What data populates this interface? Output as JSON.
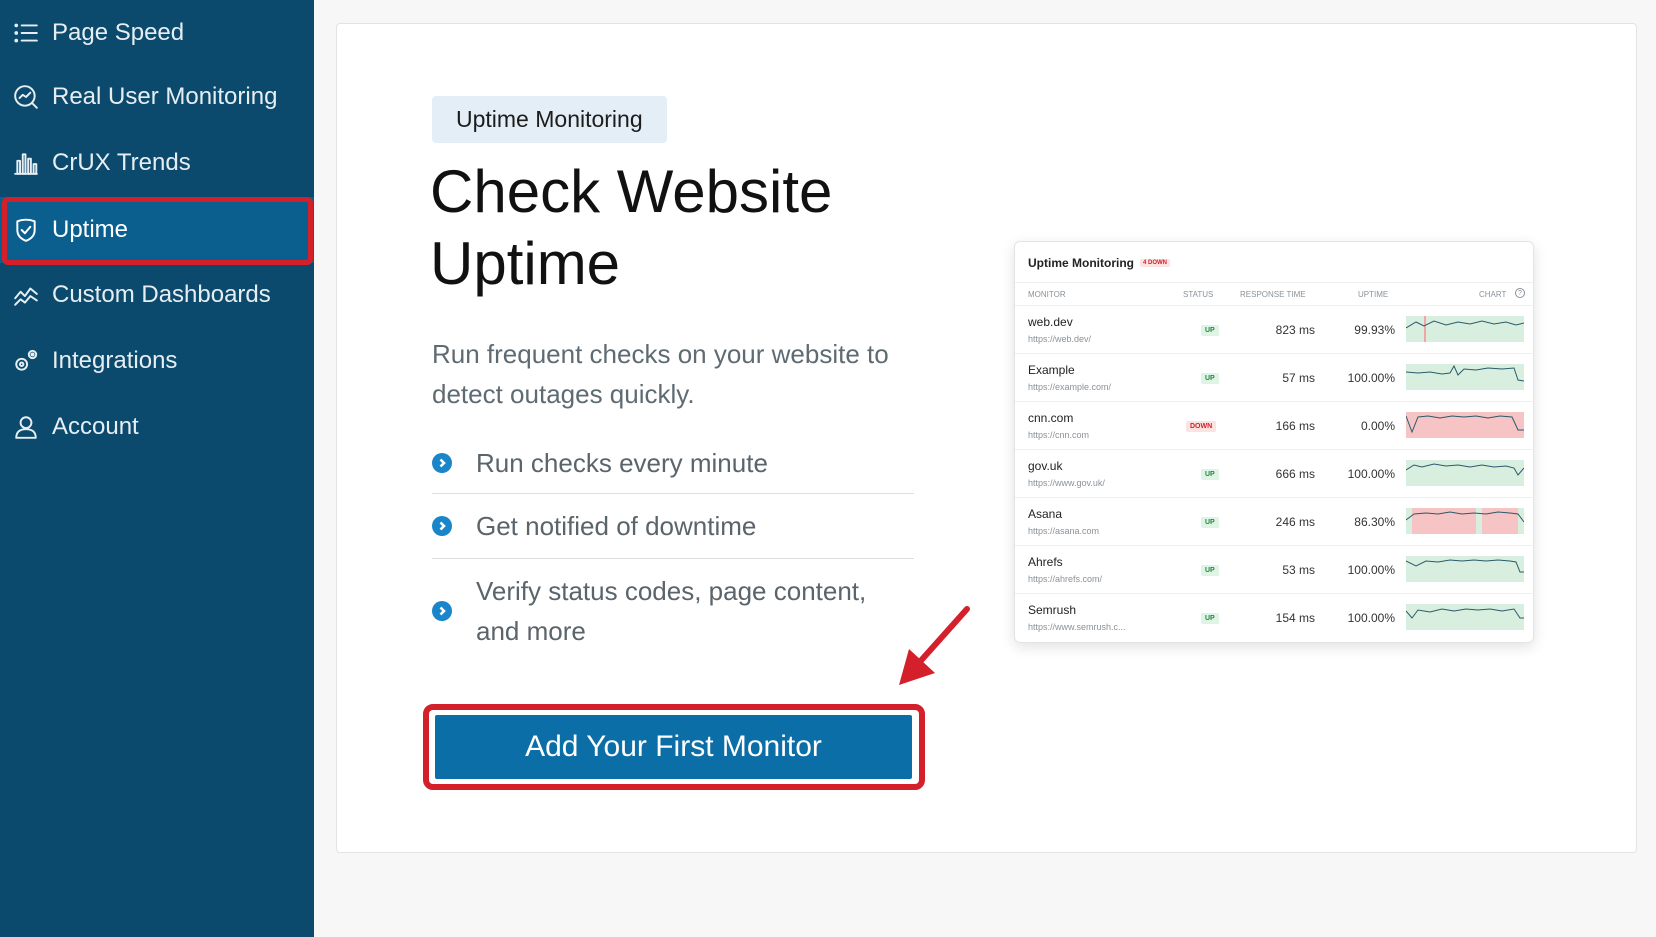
{
  "sidebar": {
    "items": [
      {
        "label": "Page Speed",
        "icon": "list-icon"
      },
      {
        "label": "Real User Monitoring",
        "icon": "monitor-chart-icon"
      },
      {
        "label": "CrUX Trends",
        "icon": "bar-chart-icon"
      },
      {
        "label": "Uptime",
        "icon": "shield-check-icon",
        "active": true
      },
      {
        "label": "Custom Dashboards",
        "icon": "trend-line-icon"
      },
      {
        "label": "Integrations",
        "icon": "gears-icon"
      },
      {
        "label": "Account",
        "icon": "user-icon"
      }
    ]
  },
  "main": {
    "tag": "Uptime Monitoring",
    "headline": "Check Website Uptime",
    "lead": "Run frequent checks on your website to detect outages quickly.",
    "features": [
      "Run checks every minute",
      "Get notified of downtime",
      "Verify status codes, page content, and more"
    ],
    "cta_label": "Add Your First Monitor"
  },
  "preview": {
    "title": "Uptime Monitoring",
    "badge": "4 DOWN",
    "columns": [
      "MONITOR",
      "STATUS",
      "RESPONSE TIME",
      "UPTIME",
      "CHART"
    ],
    "rows": [
      {
        "name": "web.dev",
        "url": "https://web.dev/",
        "status": "UP",
        "response": "823 ms",
        "uptime": "99.93%"
      },
      {
        "name": "Example",
        "url": "https://example.com/",
        "status": "UP",
        "response": "57 ms",
        "uptime": "100.00%"
      },
      {
        "name": "cnn.com",
        "url": "https://cnn.com",
        "status": "DOWN",
        "response": "166 ms",
        "uptime": "0.00%"
      },
      {
        "name": "gov.uk",
        "url": "https://www.gov.uk/",
        "status": "UP",
        "response": "666 ms",
        "uptime": "100.00%"
      },
      {
        "name": "Asana",
        "url": "https://asana.com",
        "status": "UP",
        "response": "246 ms",
        "uptime": "86.30%"
      },
      {
        "name": "Ahrefs",
        "url": "https://ahrefs.com/",
        "status": "UP",
        "response": "53 ms",
        "uptime": "100.00%"
      },
      {
        "name": "Semrush",
        "url": "https://www.semrush.c...",
        "status": "UP",
        "response": "154 ms",
        "uptime": "100.00%"
      }
    ]
  },
  "colors": {
    "sidebar_bg": "#0b4a6c",
    "active_bg": "#0b5f8e",
    "highlight_red": "#d3202a",
    "cta_bg": "#0c6ea6",
    "bullet_blue": "#1a86c9"
  }
}
